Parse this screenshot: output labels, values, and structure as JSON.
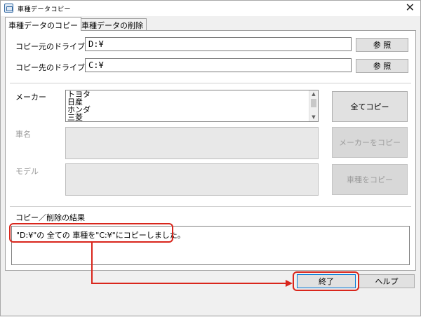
{
  "window": {
    "title": "車種データコピー",
    "close": "✕"
  },
  "tabs": [
    {
      "label": "車種データのコピー"
    },
    {
      "label": "車種データの削除"
    }
  ],
  "source": {
    "label": "コピー元のドライブ",
    "value": "D:¥",
    "browse": "参 照"
  },
  "dest": {
    "label": "コピー先のドライブ",
    "value": "C:¥",
    "browse": "参 照"
  },
  "maker": {
    "label": "メーカー",
    "items": [
      "トヨタ",
      "日産",
      "ホンダ",
      "三菱"
    ]
  },
  "car": {
    "label": "車名"
  },
  "model": {
    "label": "モデル"
  },
  "buttons": {
    "copy_all": "全てコピー",
    "copy_maker": "メーカーをコピー",
    "copy_car": "車種をコピー",
    "finish": "終了",
    "help": "ヘルプ"
  },
  "result": {
    "label": "コピー／削除の結果",
    "message": "\"D:¥\"の 全ての 車種を\"C:¥\"にコピーしました。"
  },
  "colors": {
    "highlight": "#d9261c",
    "accent": "#0078d7"
  }
}
